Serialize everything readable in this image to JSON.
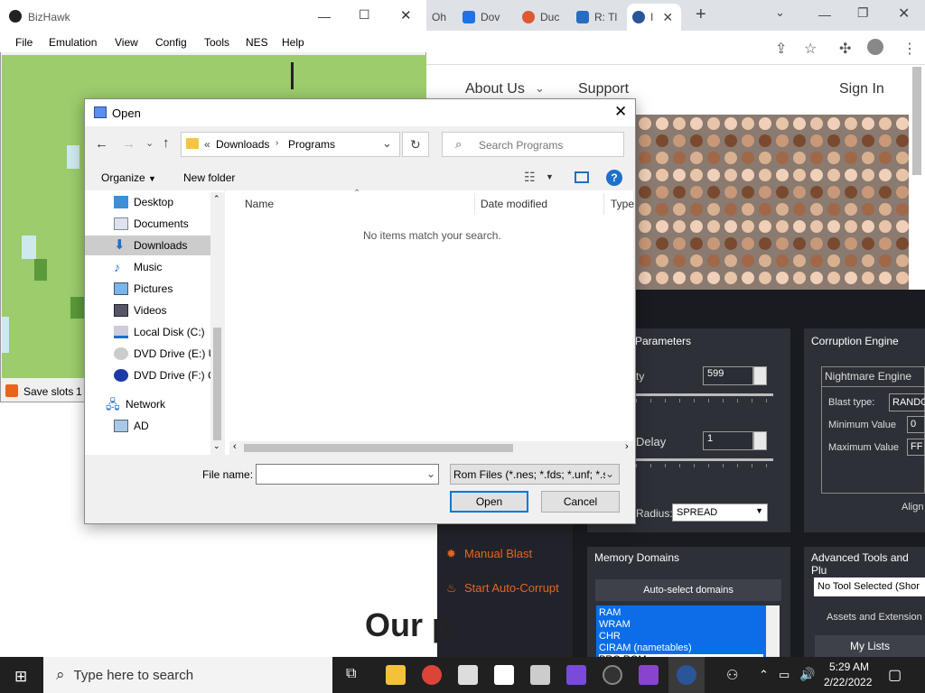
{
  "browser": {
    "tabs": [
      "Oh",
      "Dov",
      "Duc",
      "R: Tl",
      "I"
    ],
    "nav": {
      "about": "About Us",
      "support": "Support",
      "signin": "Sign In"
    },
    "heading_partial": "Our p"
  },
  "rtc": {
    "parameters_title": "Parameters",
    "intensity_label": "ty",
    "intensity_value": "599",
    "delay_label": "Delay",
    "delay_value": "1",
    "radius_label": "Radius:",
    "radius_value": "SPREAD",
    "manual_blast": "Manual Blast",
    "auto_corrupt": "Start Auto-Corrupt",
    "engine_title": "Corruption Engine",
    "engine_value": "Nightmare Engine",
    "blast_type_label": "Blast type:",
    "blast_type_value": "RANDO",
    "min_label": "Minimum Value",
    "min_value": "0",
    "max_label": "Maximum Value",
    "max_value": "FF",
    "align_label": "Align",
    "memory_title": "Memory Domains",
    "autoselect": "Auto-select domains",
    "domains": [
      "RAM",
      "WRAM",
      "CHR",
      "CIRAM (nametables)",
      "PRG ROM"
    ],
    "adv_title": "Advanced Tools and Plu",
    "no_tool": "No Tool Selected (Shor",
    "assets": "Assets and Extension",
    "my_lists": "My Lists"
  },
  "bizhawk": {
    "title": "BizHawk",
    "menu": [
      "File",
      "Emulation",
      "View",
      "Config",
      "Tools",
      "NES",
      "Help"
    ],
    "status": "Save slots",
    "status_num": "1"
  },
  "dialog": {
    "title": "Open",
    "breadcrumb": [
      "Downloads",
      "Programs"
    ],
    "search_placeholder": "Search Programs",
    "organize": "Organize",
    "new_folder": "New folder",
    "nav_items": [
      "Desktop",
      "Documents",
      "Downloads",
      "Music",
      "Pictures",
      "Videos",
      "Local Disk (C:)",
      "DVD Drive (E:) UI",
      "DVD Drive (F:) Co"
    ],
    "network": "Network",
    "ad": "AD",
    "col_name": "Name",
    "col_date": "Date modified",
    "col_type": "Type",
    "empty_msg": "No items match your search.",
    "filename_label": "File name:",
    "filename_value": "",
    "filter": "Rom Files (*.nes; *.fds; *.unf; *.s",
    "open": "Open",
    "cancel": "Cancel"
  },
  "taskbar": {
    "search_placeholder": "Type here to search",
    "time": "5:29 AM",
    "date": "2/22/2022"
  },
  "colors": {
    "accent": "#0078d7",
    "rtc_bg": "#1a1b20",
    "game_bg": "#9ccc6c",
    "blast": "#e8641c"
  }
}
